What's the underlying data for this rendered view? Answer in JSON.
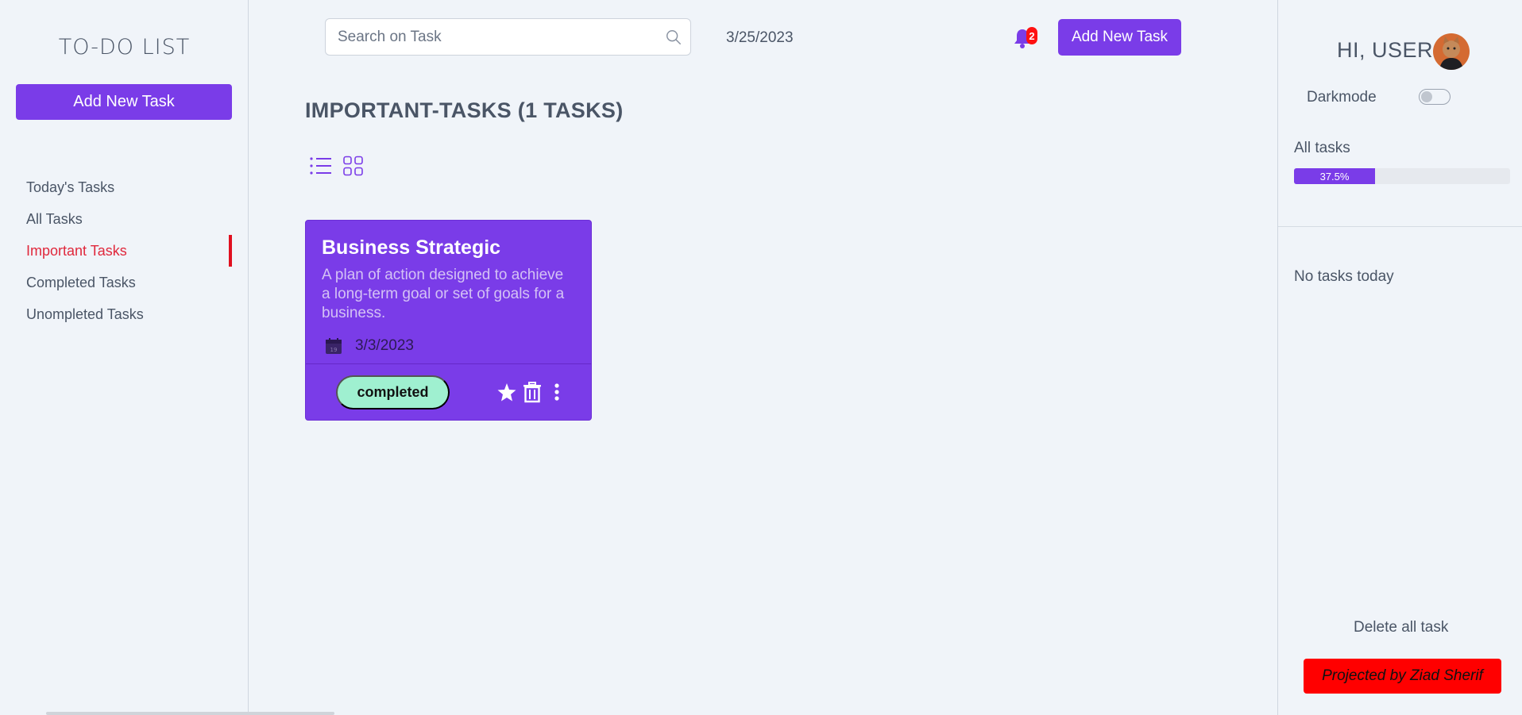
{
  "app": {
    "title": "TO-DO LIST"
  },
  "sidebar": {
    "add_button": "Add New Task",
    "items": [
      {
        "label": "Today's Tasks",
        "active": false
      },
      {
        "label": "All Tasks",
        "active": false
      },
      {
        "label": "Important Tasks",
        "active": true
      },
      {
        "label": "Completed Tasks",
        "active": false
      },
      {
        "label": "Unompleted Tasks",
        "active": false
      }
    ]
  },
  "header": {
    "search_placeholder": "Search on Task",
    "search_value": "",
    "date": "3/25/2023",
    "notification_count": "2",
    "add_button": "Add New Task"
  },
  "main": {
    "heading": "IMPORTANT-TASKS (1 TASKS)",
    "view_modes": [
      "list-view-icon",
      "grid-view-icon"
    ],
    "tasks": [
      {
        "title": "Business Strategic",
        "description": "A plan of action designed to achieve a long-term goal or set of goals for a business.",
        "date": "3/3/2023",
        "status": "completed",
        "important": true
      }
    ]
  },
  "right_panel": {
    "greeting": "HI, USER",
    "darkmode_label": "Darkmode",
    "darkmode_on": false,
    "all_tasks_label": "All tasks",
    "progress_text": "37.5%",
    "progress_value": 0.375,
    "no_tasks_text": "No tasks today",
    "delete_all": "Delete all task",
    "credit": "Projected by Ziad Sherif"
  },
  "colors": {
    "accent": "#7a3ce8",
    "active_nav": "#e0283c",
    "status_completed": "#9ff0d0",
    "credit_bg": "#ff0000",
    "background": "#f0f4f9"
  }
}
